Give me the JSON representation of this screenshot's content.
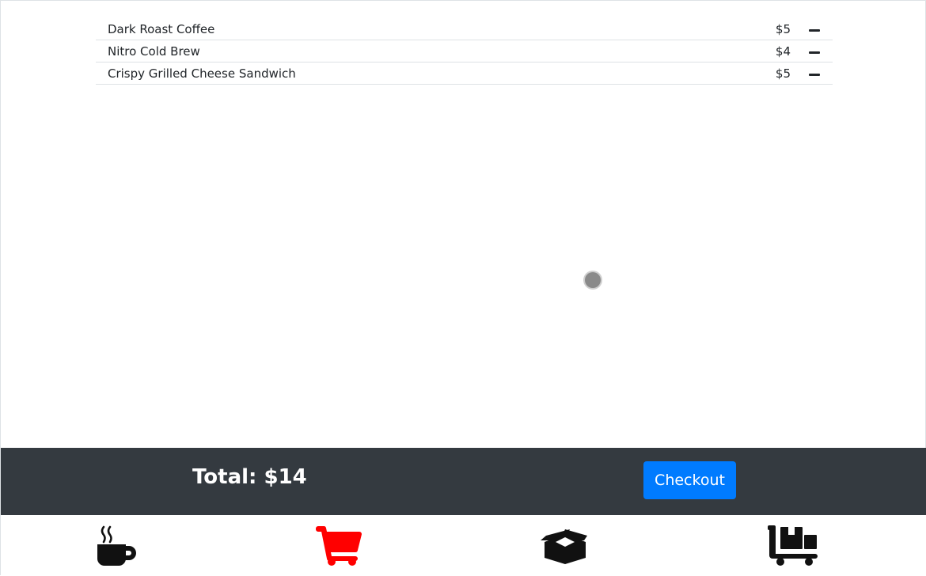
{
  "cart": {
    "items": [
      {
        "name": "Dark Roast Coffee",
        "price": "$5"
      },
      {
        "name": "Nitro Cold Brew",
        "price": "$4"
      },
      {
        "name": "Crispy Grilled Cheese Sandwich",
        "price": "$5"
      }
    ]
  },
  "footer": {
    "total_label": "Total: $14",
    "checkout_label": "Checkout"
  },
  "colors": {
    "footer_bg": "#343a40",
    "checkout_bg": "#007bff",
    "active_nav": "#ff0000",
    "inactive_nav": "#111111"
  },
  "nav": {
    "items": [
      {
        "icon": "coffee-cup-icon",
        "active": false
      },
      {
        "icon": "shopping-cart-icon",
        "active": true
      },
      {
        "icon": "open-box-icon",
        "active": false
      },
      {
        "icon": "dolly-boxes-icon",
        "active": false
      }
    ]
  }
}
